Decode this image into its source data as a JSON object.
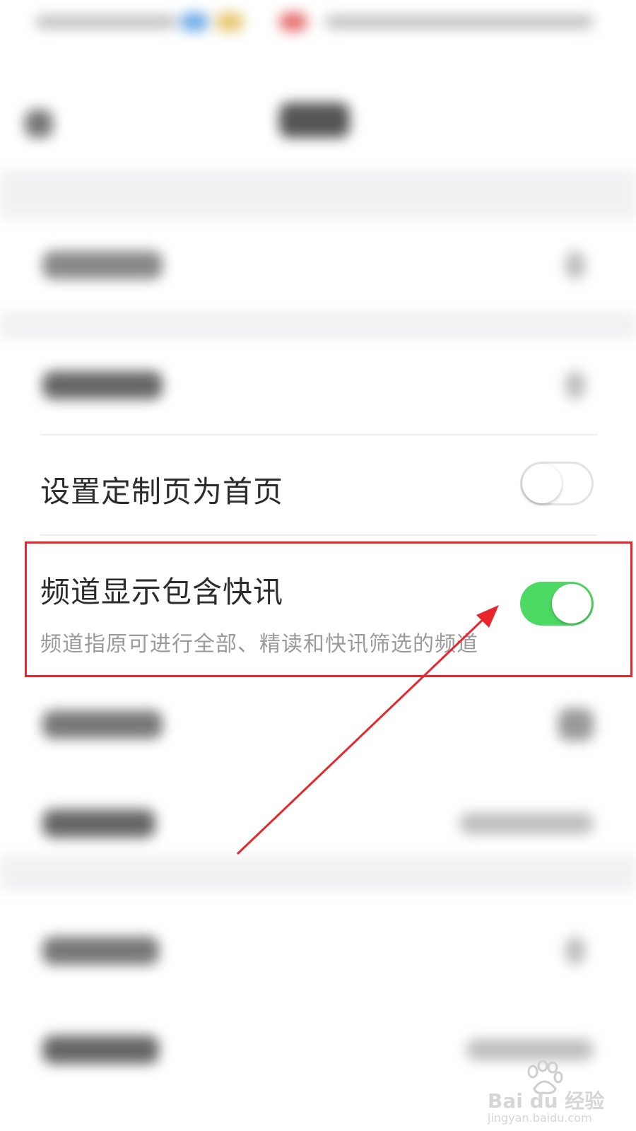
{
  "settings": {
    "set_custom_home": {
      "label": "设置定制页为首页",
      "enabled": false
    },
    "channel_flash": {
      "label": "频道显示包含快讯",
      "description": "频道指原可进行全部、精读和快讯筛选的频道",
      "enabled": true
    }
  },
  "colors": {
    "toggle_on": "#4cd964",
    "highlight": "#e8262c",
    "arrow": "#e8262c"
  },
  "watermark": {
    "brand": "Bai du 经验",
    "url": "jingyan.baidu.com"
  }
}
